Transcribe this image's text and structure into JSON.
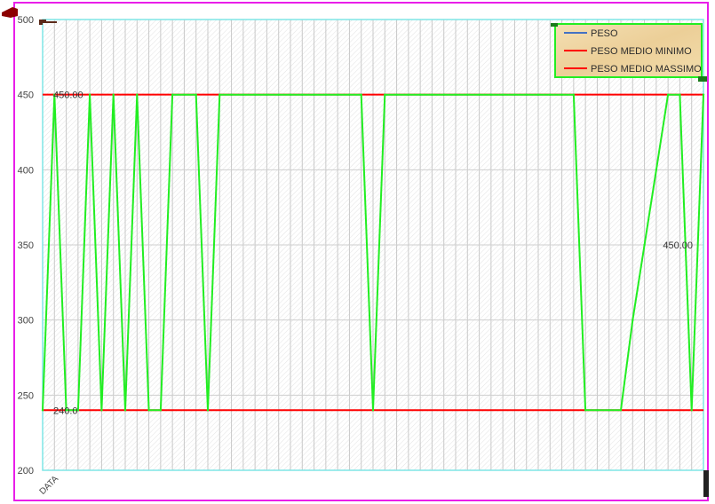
{
  "chart_data": {
    "type": "line",
    "xlabel": "DATA",
    "ylabel": "",
    "ylim": [
      200,
      500
    ],
    "yticks": [
      250,
      300,
      350,
      400,
      450,
      500
    ],
    "ytick_labels": [
      "250",
      "300",
      "350",
      "400",
      "450",
      "500"
    ],
    "extra_ytick_label": "200",
    "grid": true,
    "legend_position": "top-right",
    "legend": [
      {
        "label": "PESO",
        "color": "#4472c4"
      },
      {
        "label": "PESO MEDIO MINIMO",
        "color": "#ff0000"
      },
      {
        "label": "PESO MEDIO MASSIMO",
        "color": "#ff0000"
      }
    ],
    "series": [
      {
        "name": "PESO",
        "color": "#22ee22",
        "values": [
          240,
          450,
          240,
          240,
          450,
          240,
          450,
          240,
          450,
          240,
          240,
          450,
          450,
          450,
          240,
          450,
          450,
          450,
          450,
          450,
          450,
          450,
          450,
          450,
          450,
          450,
          450,
          450,
          240,
          450,
          450,
          450,
          450,
          450,
          450,
          450,
          450,
          450,
          450,
          450,
          450,
          450,
          450,
          450,
          450,
          450,
          240,
          240,
          240,
          240,
          300,
          350,
          400,
          450,
          450,
          240,
          450
        ]
      },
      {
        "name": "PESO MEDIO MINIMO",
        "color": "#ff0000",
        "value": 240
      },
      {
        "name": "PESO MEDIO MASSIMO",
        "color": "#ff0000",
        "value": 450
      }
    ],
    "data_labels": [
      {
        "text": "450.00",
        "value": 450,
        "anchor": "left"
      },
      {
        "text": "240.0",
        "value": 240,
        "anchor": "left"
      },
      {
        "text": "450.00",
        "value": 350,
        "anchor": "right"
      }
    ]
  }
}
